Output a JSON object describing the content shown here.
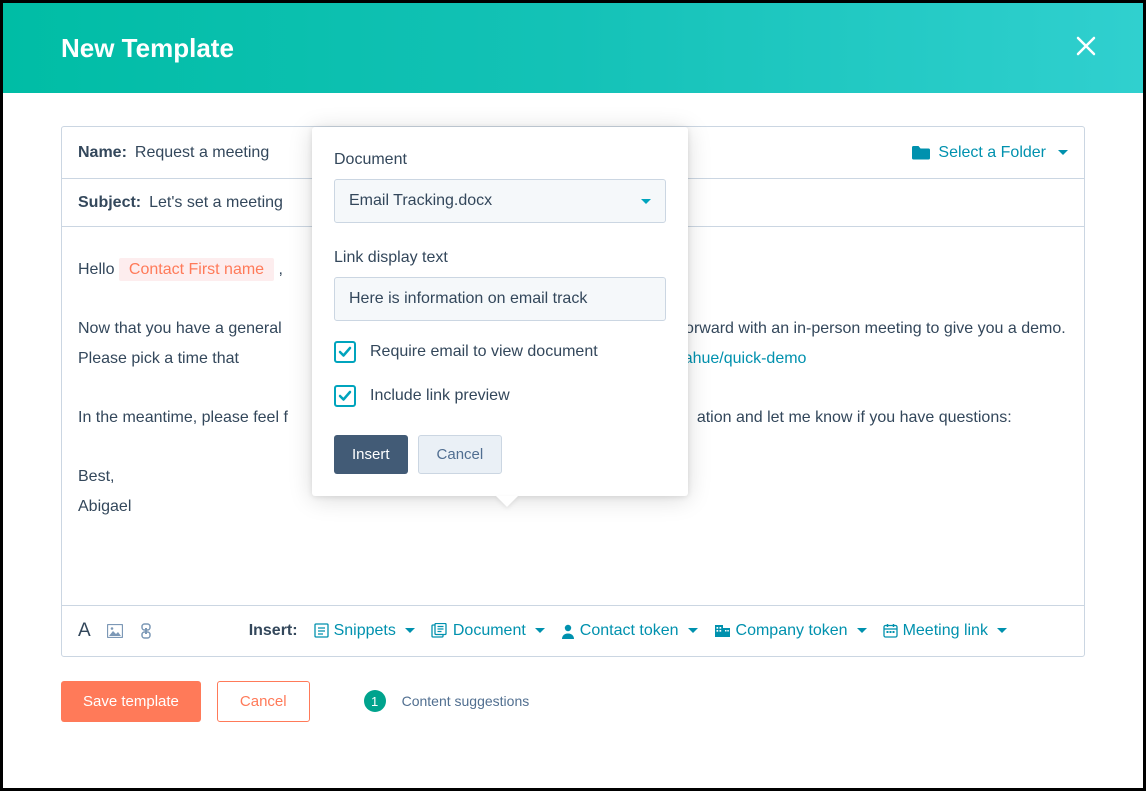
{
  "header": {
    "title": "New Template"
  },
  "fields": {
    "name_label": "Name:",
    "name_value": "Request a meeting",
    "subject_label": "Subject:",
    "subject_value": "Let's set a meeting",
    "folder_label": "Select a Folder"
  },
  "body": {
    "greeting_prefix": "Hello  ",
    "token": "Contact First name",
    "greeting_suffix": " ,",
    "p1_a": "Now that you have a general ",
    "p1_b": " forward with an in-person meeting to give you a demo. Please pick a time that",
    "link_partial": "ngs/adonahue/quick-demo",
    "p2_a": "In the meantime, please feel f",
    "p2_b": "ation and let me know if you have questions:",
    "signoff1": "Best,",
    "signoff2": "Abigael"
  },
  "toolbar": {
    "insert_label": "Insert:",
    "items": {
      "snippets": "Snippets",
      "document": "Document",
      "contact_token": "Contact token",
      "company_token": "Company token",
      "meeting_link": "Meeting link"
    }
  },
  "footer": {
    "save": "Save template",
    "cancel": "Cancel",
    "badge": "1",
    "suggestion": "Content suggestions"
  },
  "popover": {
    "doc_label": "Document",
    "doc_value": "Email Tracking.docx",
    "link_label": "Link display text",
    "link_value": "Here is information on email track",
    "check1": "Require email to view document",
    "check2": "Include link preview",
    "insert": "Insert",
    "cancel": "Cancel"
  }
}
